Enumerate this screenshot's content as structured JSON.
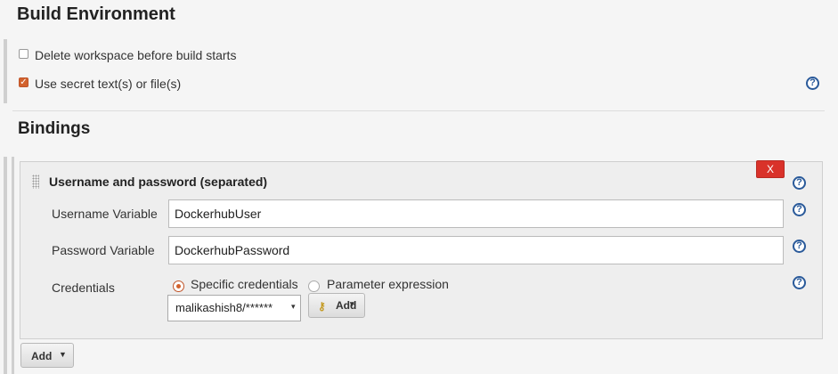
{
  "build_environment": {
    "title": "Build Environment",
    "delete_workspace_label": "Delete workspace before build starts",
    "delete_workspace_checked": false,
    "use_secret_label": "Use secret text(s) or file(s)",
    "use_secret_checked": true
  },
  "bindings": {
    "title": "Bindings",
    "binding": {
      "title": "Username and password (separated)",
      "delete_label": "X",
      "username_variable_label": "Username Variable",
      "username_variable_value": "DockerhubUser",
      "password_variable_label": "Password Variable",
      "password_variable_value": "DockerhubPassword",
      "credentials_label": "Credentials",
      "radio_specific_label": "Specific credentials",
      "radio_parameter_label": "Parameter expression",
      "selected_credential": "malikashish8/******",
      "add_credential_label": "Add"
    },
    "add_button_label": "Add"
  },
  "help_glyph": "?",
  "colors": {
    "accent_orange": "#d2622d",
    "delete_red": "#d9322a",
    "help_blue": "#2a5a9a"
  }
}
